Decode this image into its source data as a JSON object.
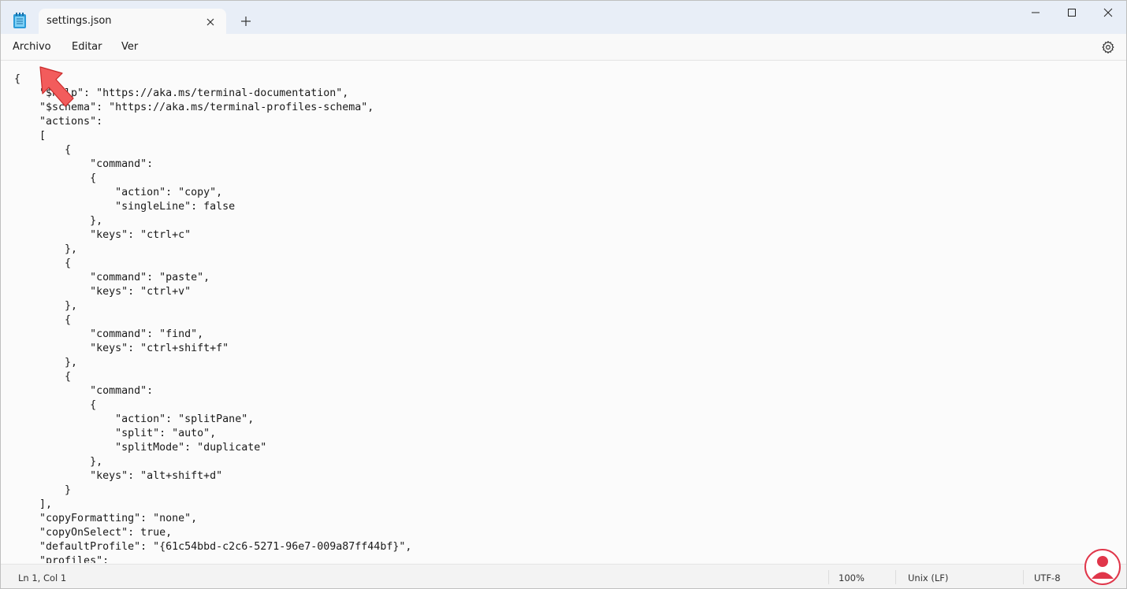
{
  "tab": {
    "title": "settings.json"
  },
  "menu": {
    "items": [
      "Archivo",
      "Editar",
      "Ver"
    ]
  },
  "editor": {
    "lines": [
      "{",
      "    \"$help\": \"https://aka.ms/terminal-documentation\",",
      "    \"$schema\": \"https://aka.ms/terminal-profiles-schema\",",
      "    \"actions\":",
      "    [",
      "        {",
      "            \"command\":",
      "            {",
      "                \"action\": \"copy\",",
      "                \"singleLine\": false",
      "            },",
      "            \"keys\": \"ctrl+c\"",
      "        },",
      "        {",
      "            \"command\": \"paste\",",
      "            \"keys\": \"ctrl+v\"",
      "        },",
      "        {",
      "            \"command\": \"find\",",
      "            \"keys\": \"ctrl+shift+f\"",
      "        },",
      "        {",
      "            \"command\":",
      "            {",
      "                \"action\": \"splitPane\",",
      "                \"split\": \"auto\",",
      "                \"splitMode\": \"duplicate\"",
      "            },",
      "            \"keys\": \"alt+shift+d\"",
      "        }",
      "    ],",
      "    \"copyFormatting\": \"none\",",
      "    \"copyOnSelect\": true,",
      "    \"defaultProfile\": \"{61c54bbd-c2c6-5271-96e7-009a87ff44bf}\",",
      "    \"profiles\":"
    ]
  },
  "status": {
    "position": "Ln 1, Col 1",
    "zoom": "100%",
    "line_ending": "Unix (LF)",
    "encoding": "UTF-8"
  },
  "icons": {
    "app": "notepad-icon",
    "tab_close": "close-icon",
    "new_tab": "plus-icon",
    "minimize": "minimize-icon",
    "maximize": "maximize-icon",
    "close": "close-window-icon",
    "settings": "gear-icon",
    "annotation": "red-arrow-icon",
    "watermark": "logo-icon"
  },
  "colors": {
    "titlebar": "#e8eef7",
    "annotation_arrow": "#f25c5c",
    "watermark": "#e0364a"
  }
}
